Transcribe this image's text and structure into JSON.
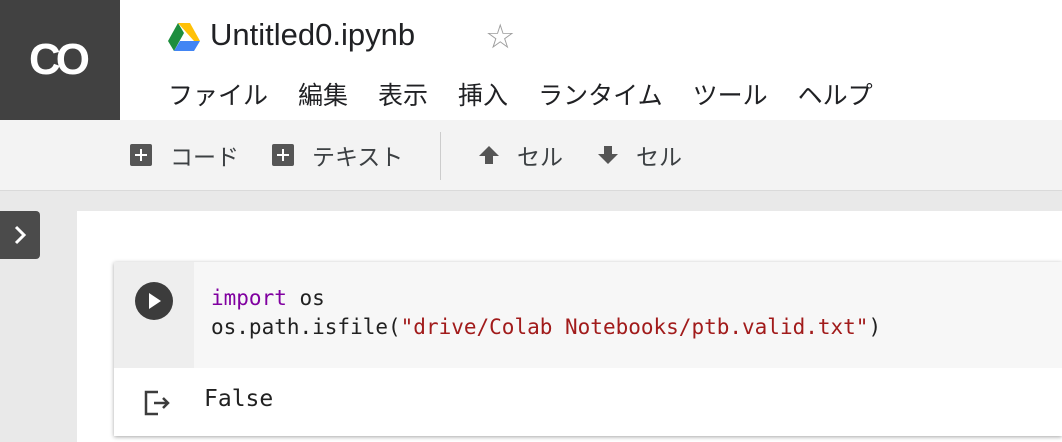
{
  "header": {
    "logo_text": "CO",
    "drive_icon": "google-drive-icon",
    "file_title": "Untitled0.ipynb",
    "star_icon": "star-outline-icon"
  },
  "menu": [
    {
      "label": "ファイル"
    },
    {
      "label": "編集"
    },
    {
      "label": "表示"
    },
    {
      "label": "挿入"
    },
    {
      "label": "ランタイム"
    },
    {
      "label": "ツール"
    },
    {
      "label": "ヘルプ"
    }
  ],
  "toolbar": {
    "add_code_label": "コード",
    "add_text_label": "テキスト",
    "cell_up_label": "セル",
    "cell_down_label": "セル"
  },
  "cell": {
    "code_keyword": "import",
    "code_line1_rest": " os",
    "code_line2_prefix": "os.path.isfile(",
    "code_line2_string": "\"drive/Colab Notebooks/ptb.valid.txt\"",
    "code_line2_suffix": ")",
    "output": "False"
  },
  "colors": {
    "logo_bg": "#414141",
    "keyword": "#8000a0",
    "string": "#a11b1b"
  }
}
